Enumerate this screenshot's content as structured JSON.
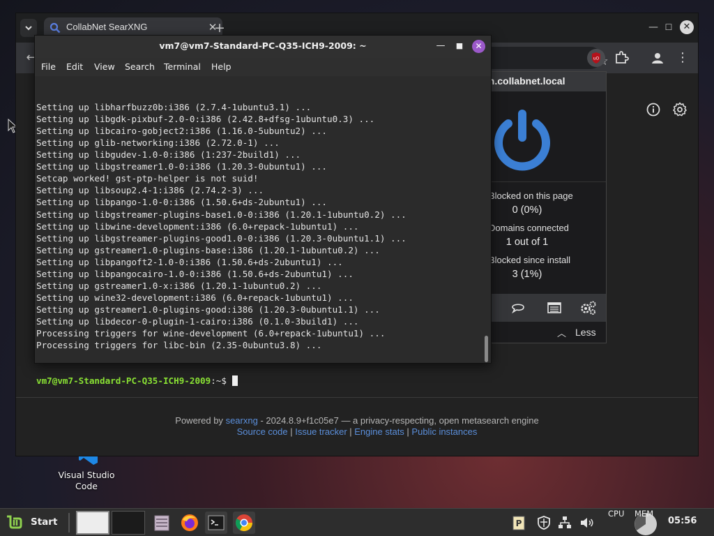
{
  "desktop": {
    "shortcut_vscode": "Visual Studio Code"
  },
  "browser": {
    "tab_title": "CollabNet SearXNG",
    "tab_close": "✕",
    "new_tab": "+",
    "footer": {
      "powered_by": "Powered by",
      "searxng_link": "searxng",
      "version_text": "- 2024.8.9+f1c05e7 — a privacy-respecting, open metasearch engine",
      "links": [
        "Source code",
        "Issue tracker",
        "Engine stats",
        "Public instances"
      ],
      "separator": " | "
    }
  },
  "ublock_popup": {
    "hostname": "ch.collabnet.local",
    "stats": [
      {
        "label": "Blocked on this page",
        "value": "0 (0%)"
      },
      {
        "label": "Domains connected",
        "value": "1 out of 1"
      },
      {
        "label": "Blocked since install",
        "value": "3 (1%)"
      }
    ],
    "less_label": "Less",
    "accent_color": "#3b7fd4"
  },
  "terminal": {
    "title": "vm7@vm7-Standard-PC-Q35-ICH9-2009: ~",
    "menu": [
      "File",
      "Edit",
      "View",
      "Search",
      "Terminal",
      "Help"
    ],
    "lines": [
      "Setting up libharfbuzz0b:i386 (2.7.4-1ubuntu3.1) ...",
      "Setting up libgdk-pixbuf-2.0-0:i386 (2.42.8+dfsg-1ubuntu0.3) ...",
      "Setting up libcairo-gobject2:i386 (1.16.0-5ubuntu2) ...",
      "Setting up glib-networking:i386 (2.72.0-1) ...",
      "Setting up libgudev-1.0-0:i386 (1:237-2build1) ...",
      "Setting up libgstreamer1.0-0:i386 (1.20.3-0ubuntu1) ...",
      "Setcap worked! gst-ptp-helper is not suid!",
      "Setting up libsoup2.4-1:i386 (2.74.2-3) ...",
      "Setting up libpango-1.0-0:i386 (1.50.6+ds-2ubuntu1) ...",
      "Setting up libgstreamer-plugins-base1.0-0:i386 (1.20.1-1ubuntu0.2) ...",
      "Setting up libwine-development:i386 (6.0+repack-1ubuntu1) ...",
      "Setting up libgstreamer-plugins-good1.0-0:i386 (1.20.3-0ubuntu1.1) ...",
      "Setting up gstreamer1.0-plugins-base:i386 (1.20.1-1ubuntu0.2) ...",
      "Setting up libpangoft2-1.0-0:i386 (1.50.6+ds-2ubuntu1) ...",
      "Setting up libpangocairo-1.0-0:i386 (1.50.6+ds-2ubuntu1) ...",
      "Setting up gstreamer1.0-x:i386 (1.20.1-1ubuntu0.2) ...",
      "Setting up wine32-development:i386 (6.0+repack-1ubuntu1) ...",
      "Setting up gstreamer1.0-plugins-good:i386 (1.20.3-0ubuntu1.1) ...",
      "Setting up libdecor-0-plugin-1-cairo:i386 (0.1.0-3build1) ...",
      "Processing triggers for wine-development (6.0+repack-1ubuntu1) ...",
      "Processing triggers for libc-bin (2.35-0ubuntu3.8) ..."
    ],
    "prompt_user": "vm7@vm7-Standard-PC-Q35-ICH9-2009",
    "prompt_symbol": ":~$ ",
    "prompt_color": "#8ae234"
  },
  "taskbar": {
    "start_label": "Start",
    "cpu_label": "CPU",
    "mem_label": "MEM",
    "clock": "05:56",
    "apps": [
      "files-icon",
      "firefox-icon",
      "terminal-icon",
      "chrome-icon"
    ]
  }
}
